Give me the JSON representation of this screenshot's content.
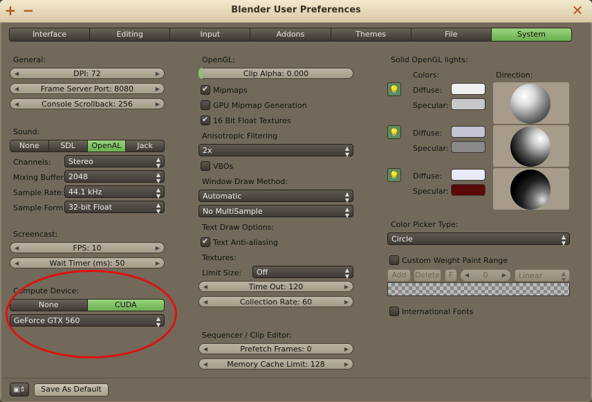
{
  "window": {
    "title": "Blender User Preferences",
    "add_icon": "plus-icon",
    "minimize_icon": "minus-icon",
    "close_icon": "close-icon"
  },
  "tabs": [
    {
      "label": "Interface"
    },
    {
      "label": "Editing"
    },
    {
      "label": "Input"
    },
    {
      "label": "Addons"
    },
    {
      "label": "Themes"
    },
    {
      "label": "File"
    },
    {
      "label": "System",
      "active": true
    }
  ],
  "general": {
    "heading": "General:",
    "dpi": "DPI: 72",
    "frame_server_port": "Frame Server Port: 8080",
    "console_scrollback": "Console Scrollback: 256"
  },
  "sound": {
    "heading": "Sound:",
    "options": [
      "None",
      "SDL",
      "OpenAL",
      "Jack"
    ],
    "selected": "OpenAL",
    "channels_label": "Channels:",
    "channels_value": "Stereo",
    "mixing_buffer_label": "Mixing Buffer",
    "mixing_buffer_value": "2048",
    "sample_rate_label": "Sample Rate:",
    "sample_rate_value": "44.1 kHz",
    "sample_form_label": "Sample Form",
    "sample_form_value": "32-bit Float"
  },
  "screencast": {
    "heading": "Screencast:",
    "fps": "FPS: 10",
    "wait_timer": "Wait Timer (ms): 50"
  },
  "compute_device": {
    "heading": "Compute Device:",
    "options": [
      "None",
      "CUDA"
    ],
    "selected": "CUDA",
    "device": "GeForce GTX 560"
  },
  "opengl": {
    "heading": "OpenGL:",
    "clip_alpha": "Clip Alpha: 0.000",
    "mipmaps": "Mipmaps",
    "gpu_mipmap": "GPU Mipmap Generation",
    "float_textures": "16 Bit Float Textures",
    "aniso_label": "Anisotropic Filtering",
    "aniso_value": "2x",
    "vbos": "VBOs",
    "window_draw_label": "Window Draw Method:",
    "window_draw_value": "Automatic",
    "multisample_value": "No MultiSample",
    "text_draw_label": "Text Draw Options:",
    "text_aa": "Text Anti-aliasing",
    "textures_label": "Textures:",
    "limit_size_label": "Limit Size:",
    "limit_size_value": "Off",
    "time_out": "Time Out: 120",
    "collection_rate": "Collection Rate: 60"
  },
  "sequencer": {
    "heading": "Sequencer / Clip Editor:",
    "prefetch": "Prefetch Frames: 0",
    "memory_cache": "Memory Cache Limit: 128"
  },
  "lights": {
    "heading": "Solid OpenGL lights:",
    "colors_label": "Colors:",
    "direction_label": "Direction:",
    "diffuse_label": "Diffuse:",
    "specular_label": "Specular:",
    "light_icon": "lightbulb-icon",
    "rows": [
      {
        "diffuse": "#efefef",
        "specular": "#c8c8c8"
      },
      {
        "diffuse": "#c3c3d2",
        "specular": "#8a8a8a"
      },
      {
        "diffuse": "#e9e9f8",
        "specular": "#5a0a0a"
      }
    ]
  },
  "color_picker": {
    "label": "Color Picker Type:",
    "value": "Circle"
  },
  "weight_paint": {
    "label": "Custom Weight Paint Range",
    "add": "Add",
    "delete": "Delete",
    "f": "F",
    "value": "0",
    "interp": "Linear"
  },
  "international_fonts": "International Fonts",
  "footer": {
    "save_default": "Save As Default",
    "editor_icon": "editor-type-icon"
  },
  "colors": {
    "accent_green": "#8bc571",
    "highlight_circle": "#e01010"
  }
}
